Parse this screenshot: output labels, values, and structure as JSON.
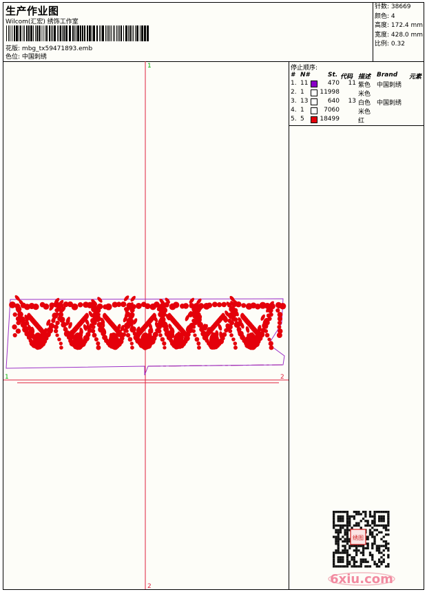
{
  "header": {
    "title": "生产作业图",
    "studio": "Wilcom(汇宏) 绣饰工作室",
    "file_label": "花版:",
    "file_name": "mbg_tx59471893.emb",
    "position_label": "色位:",
    "position_value": "中国刺绣"
  },
  "stats": {
    "stitches": "针数: 38669",
    "colors": "颜色: 4",
    "height": "高度: 172.4 mm",
    "width": "宽度: 428.0 mm",
    "scale": "比例: 0.32"
  },
  "sequence": {
    "title": "停止顺序:",
    "headers": {
      "num": "#",
      "n": "N#",
      "st": "St.",
      "code": "代码",
      "desc": "描述",
      "brand": "Brand",
      "elem": "元素"
    },
    "rows": [
      {
        "num": "1.",
        "n": "11",
        "color": "#8a00c8",
        "st": "470",
        "code": "11",
        "desc": "紫色",
        "brand": "中国刺绣"
      },
      {
        "num": "2.",
        "n": "1",
        "color": "#ffffff",
        "st": "11998",
        "code": "",
        "desc": "米色",
        "brand": ""
      },
      {
        "num": "3.",
        "n": "13",
        "color": "#ffffff",
        "st": "640",
        "code": "13",
        "desc": "白色",
        "brand": "中国刺绣"
      },
      {
        "num": "4.",
        "n": "1",
        "color": "#ffffff",
        "st": "7060",
        "code": "",
        "desc": "米色",
        "brand": ""
      },
      {
        "num": "5.",
        "n": "5",
        "color": "#e4000a",
        "st": "18499",
        "code": "",
        "desc": "红",
        "brand": ""
      }
    ]
  },
  "markers": {
    "top": "1",
    "bottom": "2",
    "left": "1",
    "right": "2"
  },
  "colors": {
    "guide": "#e0203c",
    "marker": "#00b000",
    "outline": "#9b30c8",
    "embroidery": "#e4000a"
  },
  "watermark": {
    "site": "6xiu.com",
    "seal": "绣图"
  }
}
